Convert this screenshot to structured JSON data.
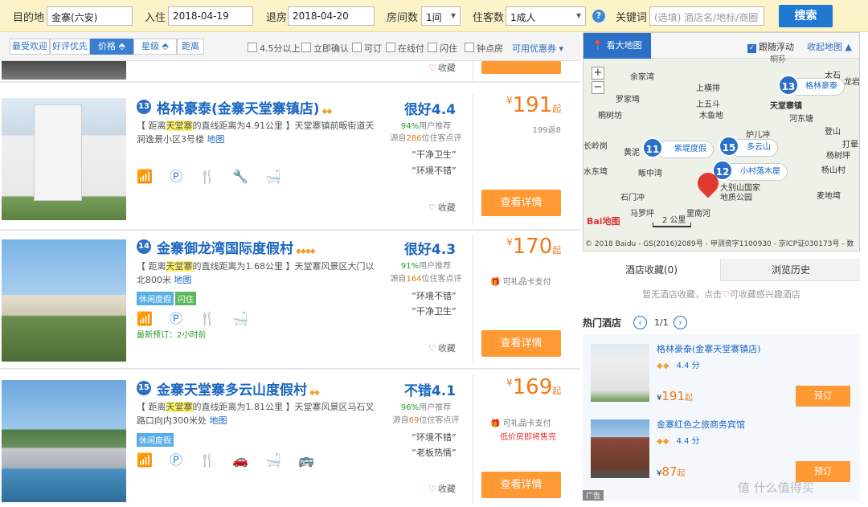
{
  "search": {
    "dest_label": "目的地",
    "dest_value": "金寨(六安)",
    "checkin_label": "入住",
    "checkin_value": "2018-04-19",
    "checkout_label": "退房",
    "checkout_value": "2018-04-20",
    "rooms_label": "房间数",
    "rooms_value": "1间",
    "guests_label": "住客数",
    "guests_value": "1成人",
    "help": "?",
    "keyword_label": "关键词",
    "keyword_placeholder": "(选填) 酒店名/地标/商圈",
    "search_btn": "搜索"
  },
  "sortbar": {
    "tabs": [
      "最受欢迎",
      "好评优先",
      "价格 ⬘",
      "星级 ⬘",
      "距离"
    ],
    "filters": [
      "4.5分以上",
      "立即确认",
      "可订",
      "在线付",
      "闪住",
      "钟点房"
    ],
    "coupon": "可用优惠券 ▾"
  },
  "first_row": {
    "fav": "收藏"
  },
  "hotels": [
    {
      "num": "13",
      "name": "格林豪泰(金寨天堂寨镇店)",
      "diam": "◆◆",
      "desc_a": "【 距离",
      "desc_hl": "天堂寨",
      "desc_b": "的直线距离为4.91公里 】天堂寨镇前畈街道天涧逸景小区3号楼",
      "map": "地图",
      "amen": "📶 Ⓟ 🍴 🔧 🛁",
      "rating": "很好4.4",
      "rec_pct": "94%",
      "rec_txt": "用户推荐",
      "src_a": "源自",
      "src_n": "286",
      "src_b": "位住客点评",
      "q1": "“干净卫生”",
      "q2": "“环境不错”",
      "fav": "收藏",
      "price_cur": "¥",
      "price": "191",
      "price_suf": "起",
      "pnote": "199返8",
      "detail": "查看详情"
    },
    {
      "num": "14",
      "name": "金寨御龙湾国际度假村",
      "diam": "◆◆◆◆",
      "desc_a": "【 距离",
      "desc_hl": "天堂寨",
      "desc_b": "的直线距离为1.68公里 】天堂寨风景区大门以北800米",
      "map": "地图",
      "tag1": "休闲度假",
      "tag2": "闪住",
      "amen": "📶 Ⓟ 🍴 🛁",
      "latest": "最新预订：2小时前",
      "rating": "很好4.3",
      "rec_pct": "91%",
      "rec_txt": "用户推荐",
      "src_a": "源自",
      "src_n": "164",
      "src_b": "位住客点评",
      "q1": "“环境不错”",
      "q2": "“干净卫生”",
      "fav": "收藏",
      "price_cur": "¥",
      "price": "170",
      "price_suf": "起",
      "gift": "可礼品卡支付",
      "detail": "查看详情"
    },
    {
      "num": "15",
      "name": "金寨天堂寨多云山度假村",
      "diam": "◆◆",
      "desc_a": "【 距离",
      "desc_hl": "天堂寨",
      "desc_b": "的直线距离为1.81公里 】天堂寨风景区马石叉路口向内300米处",
      "map": "地图",
      "tag1": "休闲度假",
      "amen": "📶 Ⓟ 🍴 🚗 🛁 🚌",
      "rating": "不错4.1",
      "rec_pct": "96%",
      "rec_txt": "用户推荐",
      "src_a": "源自",
      "src_n": "69",
      "src_b": "位住客点评",
      "q1": "“环境不错”",
      "q2": "“老板热情”",
      "fav": "收藏",
      "price_cur": "¥",
      "price": "169",
      "price_suf": "起",
      "gift": "可礼品卡支付",
      "lowprice": "低价房即将售完",
      "detail": "查看详情"
    }
  ],
  "map": {
    "big_map": "看大地图",
    "float": "跟随浮动",
    "collapse": "收起地图 ▲",
    "zoom_in": "+",
    "zoom_out": "−",
    "labels": [
      "余家湾",
      "上横排",
      "罗家塆",
      "上五斗",
      "木鱼地",
      "桐树坊",
      "天堂寨镇",
      "河东塘",
      "炉儿冲",
      "登山",
      "长岭岗",
      "黄泥",
      "畈中湾",
      "杨树坪",
      "水东塆",
      "杨山村",
      "石门冲",
      "麦地塆",
      "马罗坪",
      "里南河",
      "大别山国家地质公园",
      "打晕",
      "太石",
      "龙岩",
      "桐荪"
    ],
    "pins": [
      {
        "num": "13",
        "name": "格林豪泰"
      },
      {
        "num": "11",
        "name": "紫堤度假"
      },
      {
        "num": "15",
        "name": "多云山"
      },
      {
        "num": "12",
        "name": "小村落木屋"
      }
    ],
    "scale": "2 公里",
    "logo": "Bai地图",
    "copyright": "© 2018 Baidu - GS(2016)2089号 - 甲测资字1100930 - 京ICP证030173号 - 数"
  },
  "side_tabs": {
    "fav": "酒店收藏(0)",
    "history": "浏览历史",
    "empty_a": "暂无酒店收藏，点击",
    "empty_b": "可收藏感兴趣酒店"
  },
  "hot": {
    "title": "热门酒店",
    "page": "1/1",
    "items": [
      {
        "name": "格林豪泰(金寨天堂寨镇店)",
        "diam": "◆◆",
        "score": "4.4 分",
        "price_cur": "¥",
        "price": "191",
        "suf": "起",
        "btn": "预订"
      },
      {
        "name": "金寨红色之旅商务宾馆",
        "diam": "◆◆",
        "score": "4.4 分",
        "price_cur": "¥",
        "price": "87",
        "suf": "起",
        "btn": "预订"
      }
    ],
    "ad": "广告"
  },
  "watermark": "值 什么值得买"
}
